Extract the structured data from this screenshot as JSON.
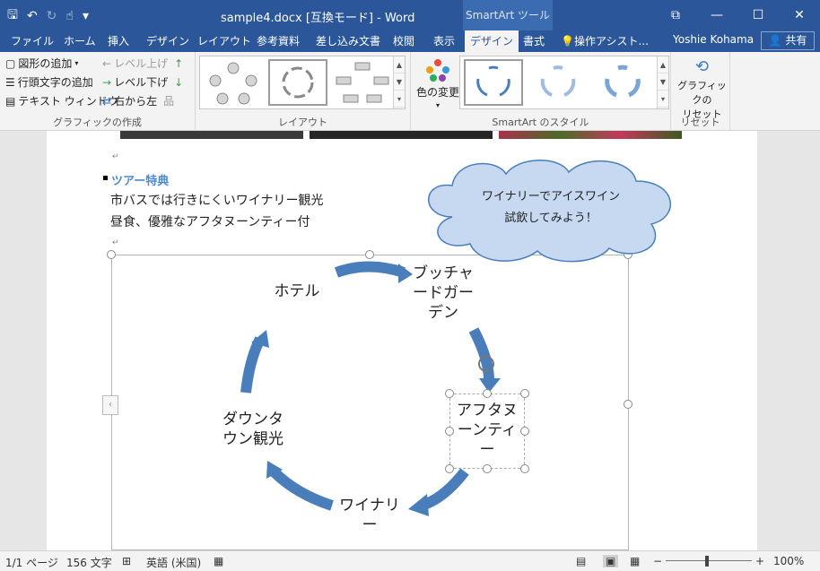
{
  "titlebar": {
    "doc_title": "sample4.docx [互換モード] - Word",
    "tool_context": "SmartArt ツール",
    "qat_save": "🖫",
    "qat_undo": "↶",
    "qat_redo": "↻",
    "qat_touch": "☝",
    "qat_more": "▾",
    "restore_ribbon": "⧉",
    "minimize": "—",
    "maximize": "☐",
    "close": "✕"
  },
  "tabs": {
    "items": [
      "ファイル",
      "ホーム",
      "挿入",
      "デザイン",
      "レイアウト",
      "参考資料",
      "差し込み文書",
      "校閲",
      "表示",
      "デザイン",
      "書式",
      "操作アシスト..."
    ],
    "user": "Yoshie Kohama",
    "share": "共有"
  },
  "ribbon": {
    "create_graphic": {
      "add_shape": "図形の追加",
      "add_bullet": "行頭文字の追加",
      "text_pane": "テキスト ウィンドウ",
      "promote": "レベル上げ",
      "demote": "レベル下げ",
      "rtl": "右から左",
      "label": "グラフィックの作成"
    },
    "layouts": {
      "label": "レイアウト"
    },
    "styles": {
      "change_colors": "色の変更",
      "label": "SmartArt のスタイル"
    },
    "reset": {
      "reset_graphic": "グラフィックの\nリセット",
      "label": "リセット"
    }
  },
  "document": {
    "heading": "ツアー特典",
    "line1": "市バスでは行きにくいワイナリー観光",
    "line2": "昼食、優雅なアフタヌーンティー付",
    "callout": "ワイナリーでアイスワイン\n試飲してみよう！",
    "nodes": {
      "hotel": "ホテル",
      "butchart": "ブッチャ\nードガー\nデン",
      "afternoon": "アフタヌ\nーンティ\nー",
      "winery": "ワイナリ\nー",
      "downtown": "ダウンタ\nウン観光"
    }
  },
  "statusbar": {
    "page": "1/1 ページ",
    "words": "156 文字",
    "language": "英語 (米国)",
    "zoom": "100%"
  },
  "colors": {
    "titlebar": "#2b579a",
    "arrow": "#4a7ebb",
    "heading": "#4a8bd6",
    "callout_fill": "#c6d9f1"
  }
}
